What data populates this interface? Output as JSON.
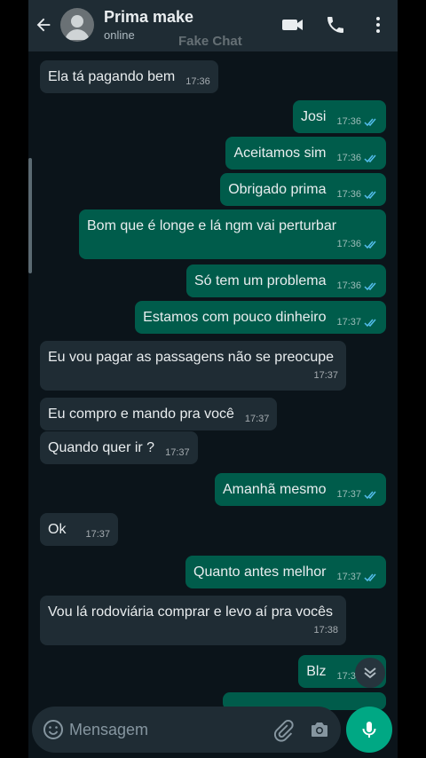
{
  "header": {
    "contact_name": "Prima make",
    "status": "online",
    "watermark": "Fake Chat"
  },
  "messages": [
    {
      "dir": "in",
      "text": "Ela tá pagando bem",
      "time": "17:36"
    },
    {
      "dir": "out",
      "text": "Josi",
      "time": "17:36"
    },
    {
      "dir": "out",
      "text": "Aceitamos sim",
      "time": "17:36"
    },
    {
      "dir": "out",
      "text": "Obrigado prima",
      "time": "17:36"
    },
    {
      "dir": "out",
      "text": "Bom que é longe e lá ngm vai perturbar",
      "time": "17:36"
    },
    {
      "dir": "out",
      "text": "Só tem um problema",
      "time": "17:36"
    },
    {
      "dir": "out",
      "text": "Estamos com pouco dinheiro",
      "time": "17:37"
    },
    {
      "dir": "in",
      "text": "Eu vou pagar as passagens não se preocupe",
      "time": "17:37"
    },
    {
      "dir": "in",
      "text": "Eu compro e mando pra você",
      "time": "17:37"
    },
    {
      "dir": "in",
      "text": "Quando quer ir ?",
      "time": "17:37"
    },
    {
      "dir": "out",
      "text": "Amanhã mesmo",
      "time": "17:37"
    },
    {
      "dir": "in",
      "text": "Ok",
      "time": "17:37"
    },
    {
      "dir": "out",
      "text": "Quanto antes melhor",
      "time": "17:37"
    },
    {
      "dir": "in",
      "text": "Vou lá rodoviária comprar e levo aí pra vocês",
      "time": "17:38"
    },
    {
      "dir": "out",
      "text": "Blz",
      "time": "17:38"
    }
  ],
  "composer": {
    "placeholder": "Mensagem"
  },
  "colors": {
    "background": "#0b141a",
    "incoming_bubble": "#1f2c34",
    "outgoing_bubble": "#005c4b",
    "accent": "#00a884",
    "read_ticks": "#53bdeb"
  },
  "icons": [
    "back-arrow-icon",
    "avatar-icon",
    "video-call-icon",
    "phone-icon",
    "more-vert-icon",
    "emoji-icon",
    "attach-icon",
    "camera-icon",
    "mic-icon",
    "chevron-down-icon"
  ]
}
